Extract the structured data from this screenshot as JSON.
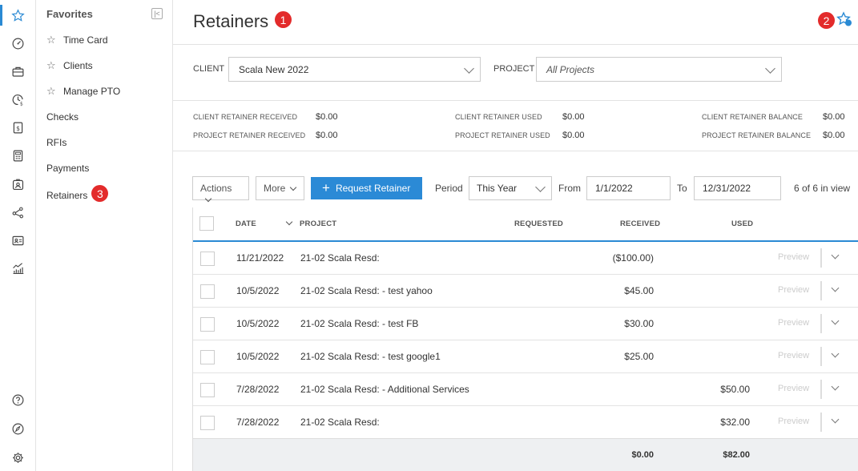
{
  "colors": {
    "accent": "#2b8ad6",
    "badge": "#e32b2b"
  },
  "rail": {
    "icons": [
      "star-icon",
      "dashboard-icon",
      "briefcase-icon",
      "clock-dollar-icon",
      "invoice-icon",
      "calculator-icon",
      "person-badge-icon",
      "share-icon",
      "contact-card-icon",
      "chart-icon",
      "help-icon",
      "rocket-icon",
      "gear-icon"
    ]
  },
  "sidebar": {
    "favorites_title": "Favorites",
    "favorites": [
      {
        "label": "Time Card"
      },
      {
        "label": "Clients"
      },
      {
        "label": "Manage PTO"
      }
    ],
    "items": [
      {
        "label": "Checks"
      },
      {
        "label": "RFIs"
      },
      {
        "label": "Payments"
      },
      {
        "label": "Retainers",
        "badge": "3"
      }
    ]
  },
  "header": {
    "title": "Retainers",
    "badge_1": "1",
    "badge_2": "2"
  },
  "filters": {
    "client_label": "CLIENT",
    "client_value": "Scala New 2022",
    "project_label": "PROJECT",
    "project_value": "All Projects"
  },
  "summary": {
    "client_retainer_received_label": "CLIENT RETAINER RECEIVED",
    "client_retainer_received": "$0.00",
    "project_retainer_received_label": "PROJECT RETAINER RECEIVED",
    "project_retainer_received": "$0.00",
    "client_retainer_used_label": "CLIENT RETAINER USED",
    "client_retainer_used": "$0.00",
    "project_retainer_used_label": "PROJECT RETAINER USED",
    "project_retainer_used": "$0.00",
    "client_retainer_balance_label": "CLIENT RETAINER BALANCE",
    "client_retainer_balance": "$0.00",
    "project_retainer_balance_label": "PROJECT RETAINER BALANCE",
    "project_retainer_balance": "$0.00"
  },
  "toolbar": {
    "actions_label": "Actions",
    "more_label": "More",
    "request_label": "Request Retainer",
    "period_label": "Period",
    "period_value": "This Year",
    "from_label": "From",
    "from_value": "1/1/2022",
    "to_label": "To",
    "to_value": "12/31/2022",
    "count_text": "6 of 6 in view"
  },
  "table": {
    "columns": {
      "date": "DATE",
      "project": "PROJECT",
      "requested": "REQUESTED",
      "received": "RECEIVED",
      "used": "USED"
    },
    "preview_label": "Preview",
    "rows": [
      {
        "date": "11/21/2022",
        "project": "21-02 Scala Resd:",
        "requested": "",
        "received": "($100.00)",
        "used": ""
      },
      {
        "date": "10/5/2022",
        "project": "21-02 Scala Resd: - test yahoo",
        "requested": "",
        "received": "$45.00",
        "used": ""
      },
      {
        "date": "10/5/2022",
        "project": "21-02 Scala Resd: - test FB",
        "requested": "",
        "received": "$30.00",
        "used": ""
      },
      {
        "date": "10/5/2022",
        "project": "21-02 Scala Resd: - test google1",
        "requested": "",
        "received": "$25.00",
        "used": ""
      },
      {
        "date": "7/28/2022",
        "project": "21-02 Scala Resd: - Additional Services",
        "requested": "",
        "received": "",
        "used": "$50.00"
      },
      {
        "date": "7/28/2022",
        "project": "21-02 Scala Resd:",
        "requested": "",
        "received": "",
        "used": "$32.00"
      }
    ],
    "totals": {
      "received": "$0.00",
      "used": "$82.00"
    }
  }
}
